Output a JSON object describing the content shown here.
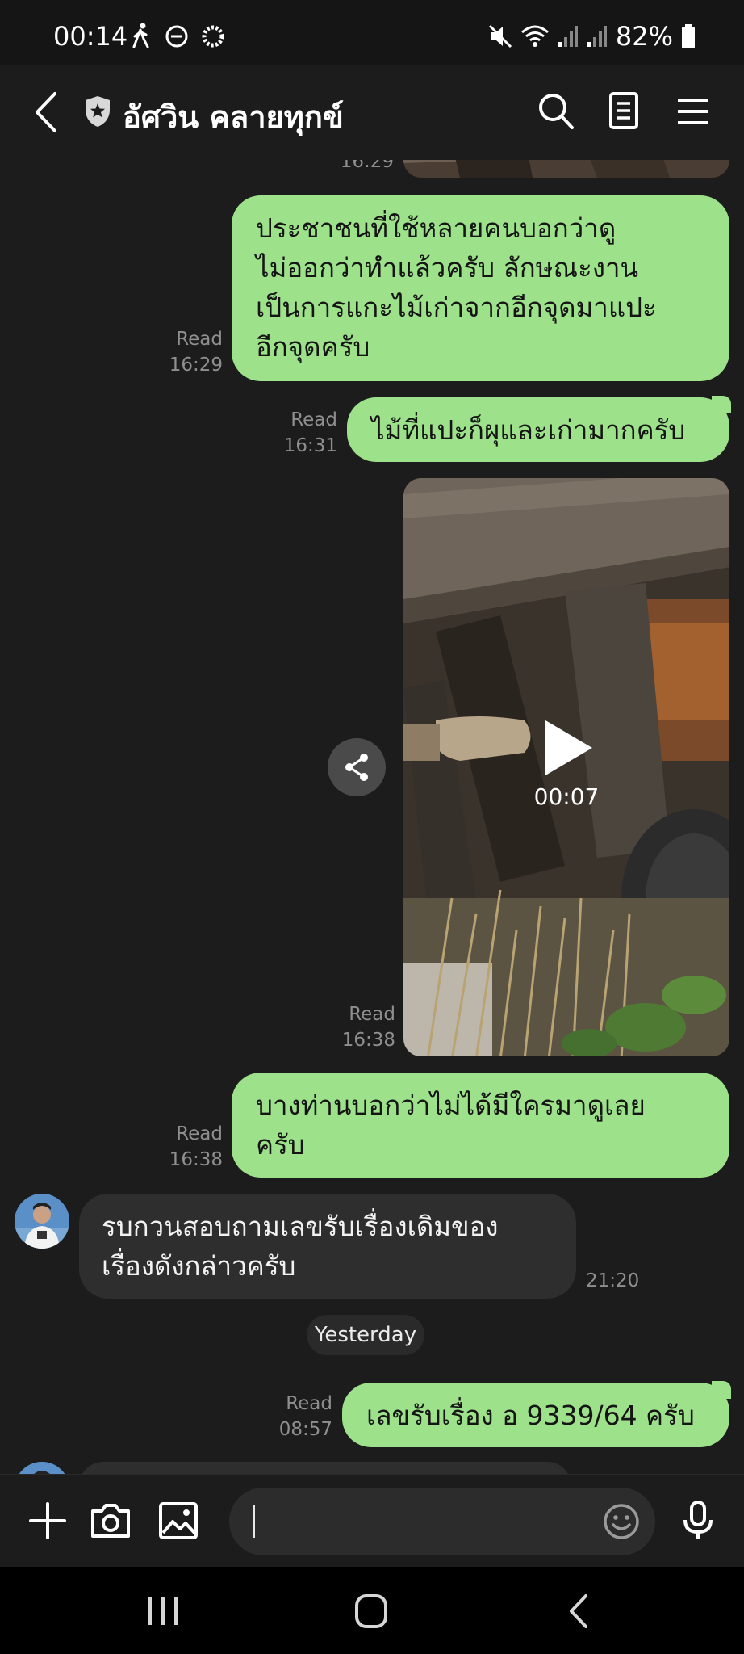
{
  "status_bar": {
    "time": "00:14",
    "battery_percent": "82%",
    "icons": [
      "walking-icon",
      "do-not-disturb-icon",
      "sync-icon",
      "mute-icon",
      "wifi-icon",
      "signal-icon",
      "signal-icon",
      "battery-icon"
    ]
  },
  "header": {
    "title": "อัศวิน คลายทุกข์",
    "icons": [
      "back-icon",
      "shield-icon",
      "search-icon",
      "notes-icon",
      "menu-icon"
    ]
  },
  "messages": [
    {
      "direction": "out",
      "lines": [
        "ประชาชนที่ใช้หลายคนบอกว่าดู",
        "ไม่ออกว่าทำแล้วครับ ลักษณะงาน",
        "เป็นการแกะไม้เก่าจากอีกจุดมาแปะ",
        "อีกจุดครับ"
      ],
      "status": "Read",
      "time": "16:29"
    },
    {
      "direction": "out",
      "lines": [
        "ไม้ที่แปะก็ผุและเก่ามากครับ"
      ],
      "status": "Read",
      "time": "16:31"
    },
    {
      "direction": "out",
      "type": "video",
      "duration": "00:07",
      "status": "Read",
      "time": "16:38"
    },
    {
      "direction": "out",
      "lines": [
        "บางท่านบอกว่าไม่ได้มีใครมาดูเลย",
        "ครับ"
      ],
      "status": "Read",
      "time": "16:38"
    },
    {
      "direction": "in",
      "lines": [
        "รบกวนสอบถามเลขรับเรื่องเดิมของ",
        "เรื่องดังกล่าวครับ"
      ],
      "time": "21:20"
    },
    {
      "direction": "out",
      "lines": [
        "เลขรับเรื่อง อ 9339/64 ครับ"
      ],
      "status": "Read",
      "time": "08:57"
    }
  ],
  "partial_above": {
    "time_fragment": "16:29"
  },
  "date_separator": "Yesterday",
  "input": {
    "placeholder": "",
    "value": "",
    "icons": [
      "plus-icon",
      "camera-icon",
      "image-icon",
      "emoji-icon",
      "microphone-icon"
    ]
  },
  "nav_bar": {
    "icons": [
      "recent-apps-icon",
      "home-icon",
      "back-icon"
    ]
  },
  "colors": {
    "outgoing_bubble": "#9de18a",
    "incoming_bubble": "#2e2e2e",
    "background": "#1c1c1c"
  }
}
